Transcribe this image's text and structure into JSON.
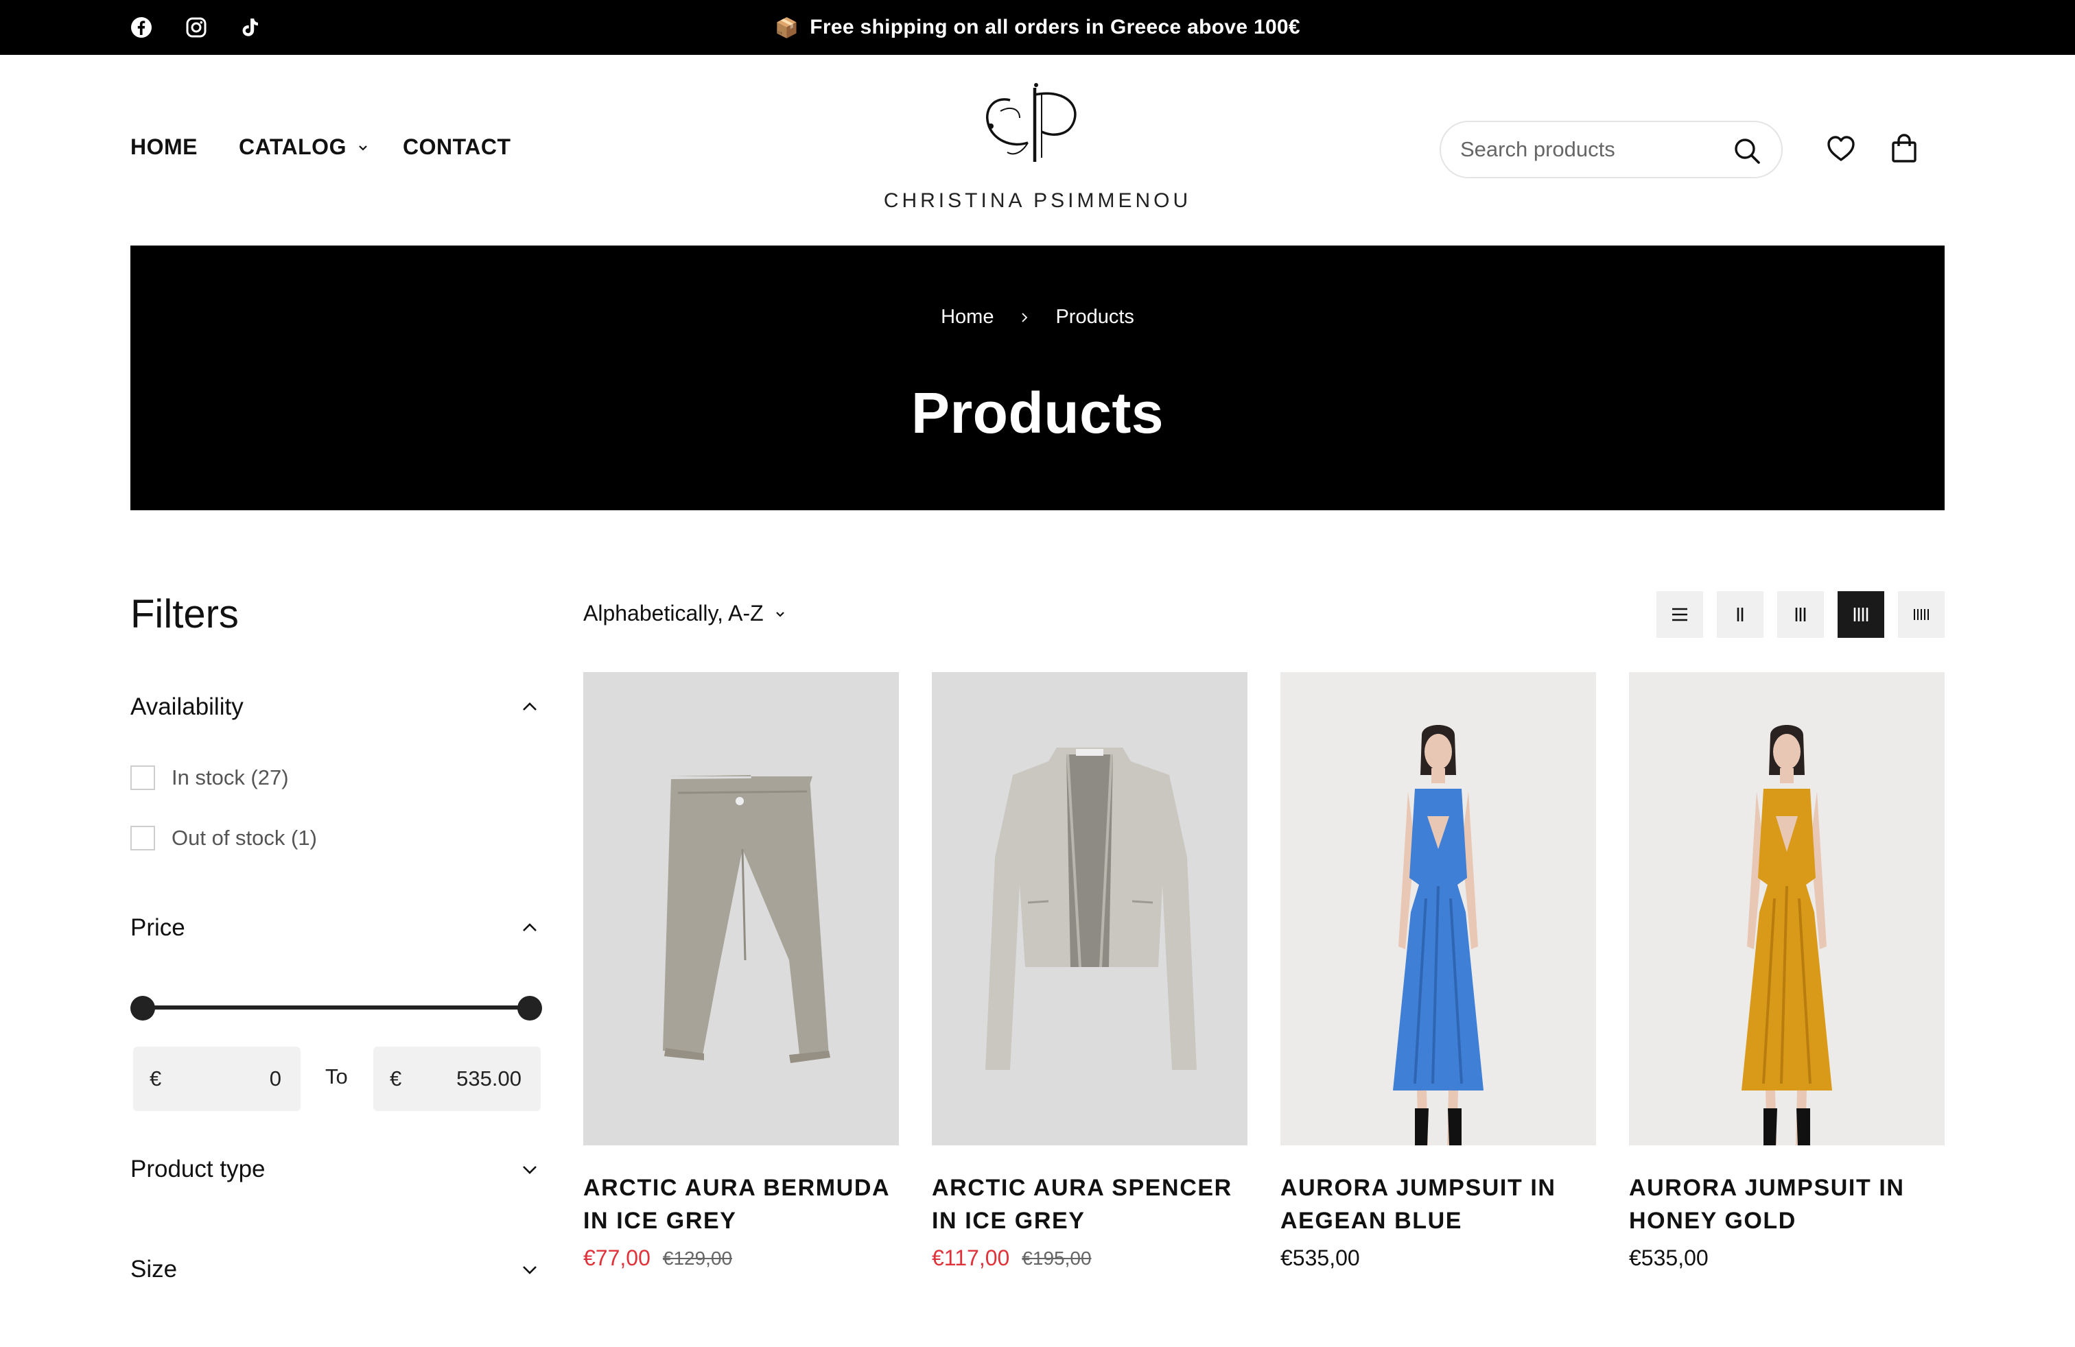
{
  "announcement": {
    "emoji": "📦",
    "text": "Free shipping on all orders in Greece above 100€"
  },
  "social": [
    "facebook-icon",
    "instagram-icon",
    "tiktok-icon"
  ],
  "nav": {
    "home": "HOME",
    "catalog": "CATALOG",
    "contact": "CONTACT"
  },
  "logo": {
    "monogram": "CP",
    "name": "CHRISTINA PSIMMENOU"
  },
  "search": {
    "placeholder": "Search products",
    "value": ""
  },
  "hero": {
    "breadcrumb_home": "Home",
    "breadcrumb_current": "Products",
    "title": "Products"
  },
  "filters": {
    "title": "Filters",
    "availability": {
      "label": "Availability",
      "options": [
        "In stock (27)",
        "Out of stock (1)"
      ]
    },
    "price": {
      "label": "Price",
      "currency": "€",
      "min_value": "0",
      "max_value": "535.00",
      "to_label": "To",
      "range_fraction": [
        0,
        1
      ]
    },
    "product_type": {
      "label": "Product type"
    },
    "size": {
      "label": "Size"
    }
  },
  "sort": {
    "selected": "Alphabetically, A-Z"
  },
  "view_modes": {
    "options": [
      "list",
      "2-columns",
      "3-columns",
      "4-columns",
      "5-columns"
    ],
    "active": "4-columns"
  },
  "products": [
    {
      "title": "ARCTIC AURA BERMUDA IN ICE GREY",
      "sale_price": "€77,00",
      "compare_price": "€129,00",
      "image": "grey-bermuda-shorts"
    },
    {
      "title": "ARCTIC AURA SPENCER IN ICE GREY",
      "sale_price": "€117,00",
      "compare_price": "€195,00",
      "image": "grey-cropped-jacket"
    },
    {
      "title": "AURORA JUMPSUIT IN AEGEAN BLUE",
      "price": "€535,00",
      "image": "model-blue-satin-jumpsuit"
    },
    {
      "title": "AURORA JUMPSUIT IN HONEY GOLD",
      "price": "€535,00",
      "image": "model-gold-satin-jumpsuit"
    }
  ],
  "colors": {
    "sale": "#e0323a",
    "topbar": "#000000",
    "hero": "#000000",
    "blue_dress": "#3f7fd6",
    "gold_dress": "#d99a1a"
  }
}
